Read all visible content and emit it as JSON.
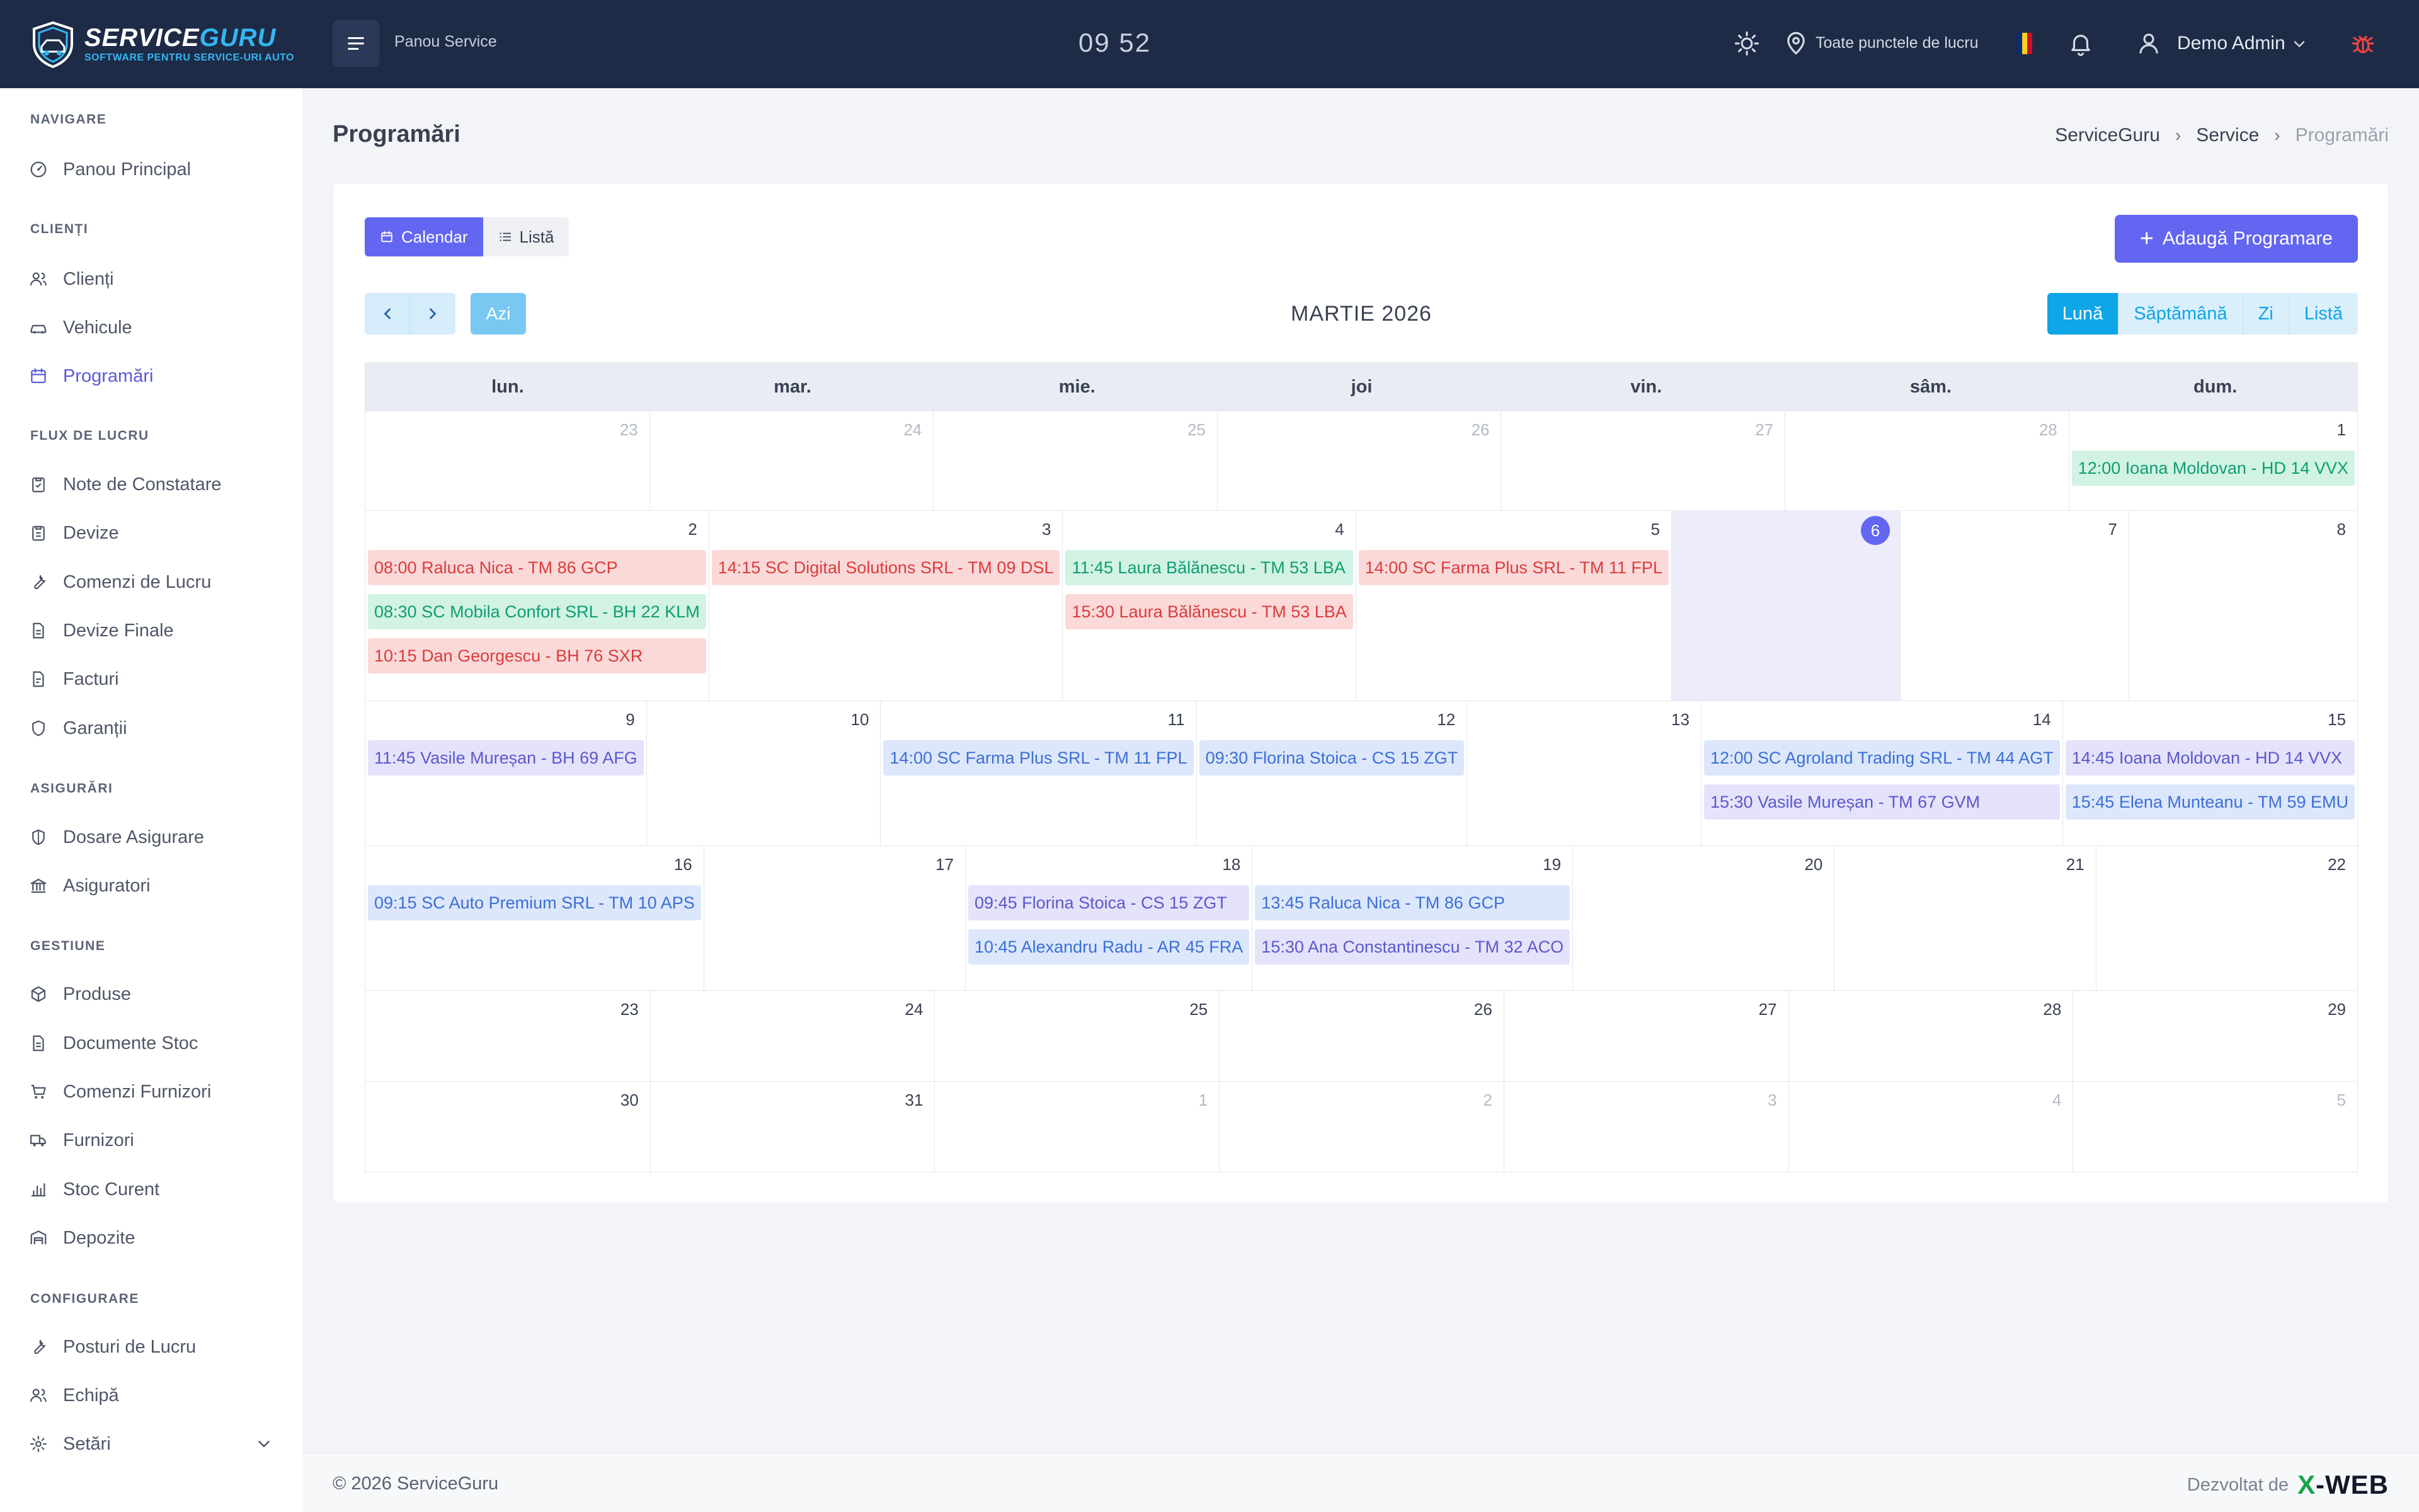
{
  "topbar": {
    "logo_title_a": "SERVICE",
    "logo_title_b": "GURU",
    "logo_subtitle": "SOFTWARE PENTRU SERVICE-URI AUTO",
    "panel_label": "Panou Service",
    "clock": "09 52",
    "location": "Toate punctele de lucru",
    "user_name": "Demo Admin"
  },
  "sidebar": {
    "sections": [
      {
        "title": "NAVIGARE",
        "items": [
          {
            "label": "Panou Principal",
            "icon": "dashboard-icon"
          }
        ]
      },
      {
        "title": "CLIENȚI",
        "items": [
          {
            "label": "Clienți",
            "icon": "users-icon"
          },
          {
            "label": "Vehicule",
            "icon": "car-icon"
          },
          {
            "label": "Programări",
            "icon": "calendar-icon",
            "active": true
          }
        ]
      },
      {
        "title": "FLUX DE LUCRU",
        "items": [
          {
            "label": "Note de Constatare",
            "icon": "clipboard-icon"
          },
          {
            "label": "Devize",
            "icon": "clipboard-icon"
          },
          {
            "label": "Comenzi de Lucru",
            "icon": "wrench-icon"
          },
          {
            "label": "Devize Finale",
            "icon": "document-icon"
          },
          {
            "label": "Facturi",
            "icon": "document-icon"
          },
          {
            "label": "Garanții",
            "icon": "shield-icon"
          }
        ]
      },
      {
        "title": "ASIGURĂRI",
        "items": [
          {
            "label": "Dosare Asigurare",
            "icon": "shield-icon"
          },
          {
            "label": "Asiguratori",
            "icon": "bank-icon"
          }
        ]
      },
      {
        "title": "GESTIUNE",
        "items": [
          {
            "label": "Produse",
            "icon": "box-icon"
          },
          {
            "label": "Documente Stoc",
            "icon": "document-icon"
          },
          {
            "label": "Comenzi Furnizori",
            "icon": "cart-icon"
          },
          {
            "label": "Furnizori",
            "icon": "truck-icon"
          },
          {
            "label": "Stoc Curent",
            "icon": "bar-chart-icon"
          },
          {
            "label": "Depozite",
            "icon": "warehouse-icon"
          }
        ]
      },
      {
        "title": "CONFIGURARE",
        "items": [
          {
            "label": "Posturi de Lucru",
            "icon": "wrench-icon"
          },
          {
            "label": "Echipă",
            "icon": "users-icon"
          },
          {
            "label": "Setări",
            "icon": "gear-icon"
          }
        ]
      }
    ]
  },
  "page": {
    "title": "Programări",
    "breadcrumb": [
      "ServiceGuru",
      "Service",
      "Programări"
    ]
  },
  "calendar": {
    "view_toggle": {
      "calendar": "Calendar",
      "list": "Listă"
    },
    "add_button": "Adaugă Programare",
    "today_button": "Azi",
    "month_title": "MARTIE 2026",
    "view_switch": [
      "Lună",
      "Săptămână",
      "Zi",
      "Listă"
    ],
    "weekdays": [
      "lun.",
      "mar.",
      "mie.",
      "joi",
      "vin.",
      "sâm.",
      "dum."
    ],
    "weeks": [
      [
        {
          "day": "23",
          "other": true,
          "events": []
        },
        {
          "day": "24",
          "other": true,
          "events": []
        },
        {
          "day": "25",
          "other": true,
          "events": []
        },
        {
          "day": "26",
          "other": true,
          "events": []
        },
        {
          "day": "27",
          "other": true,
          "events": []
        },
        {
          "day": "28",
          "other": true,
          "events": []
        },
        {
          "day": "1",
          "events": [
            {
              "text": "12:00 Ioana Moldovan - HD 14 VVX",
              "color": "green"
            }
          ]
        }
      ],
      [
        {
          "day": "2",
          "events": [
            {
              "text": "08:00 Raluca Nica - TM 86 GCP",
              "color": "red"
            },
            {
              "text": "08:30 SC Mobila Confort SRL - BH 22 KLM",
              "color": "green"
            },
            {
              "text": "10:15 Dan Georgescu - BH 76 SXR",
              "color": "red"
            }
          ]
        },
        {
          "day": "3",
          "events": [
            {
              "text": "14:15 SC Digital Solutions SRL - TM 09 DSL",
              "color": "red"
            }
          ]
        },
        {
          "day": "4",
          "events": [
            {
              "text": "11:45 Laura Bălănescu - TM 53 LBA",
              "color": "green"
            },
            {
              "text": "15:30 Laura Bălănescu - TM 53 LBA",
              "color": "red"
            }
          ]
        },
        {
          "day": "5",
          "events": [
            {
              "text": "14:00 SC Farma Plus SRL - TM 11 FPL",
              "color": "red"
            }
          ]
        },
        {
          "day": "6",
          "today": true,
          "events": []
        },
        {
          "day": "7",
          "events": []
        },
        {
          "day": "8",
          "events": []
        }
      ],
      [
        {
          "day": "9",
          "events": [
            {
              "text": "11:45 Vasile Mureșan - BH 69 AFG",
              "color": "purple"
            }
          ]
        },
        {
          "day": "10",
          "events": []
        },
        {
          "day": "11",
          "events": [
            {
              "text": "14:00 SC Farma Plus SRL - TM 11 FPL",
              "color": "blue"
            }
          ]
        },
        {
          "day": "12",
          "events": [
            {
              "text": "09:30 Florina Stoica - CS 15 ZGT",
              "color": "blue"
            }
          ]
        },
        {
          "day": "13",
          "events": []
        },
        {
          "day": "14",
          "events": [
            {
              "text": "12:00 SC Agroland Trading SRL - TM 44 AGT",
              "color": "blue"
            },
            {
              "text": "15:30 Vasile Mureșan - TM 67 GVM",
              "color": "purple"
            }
          ]
        },
        {
          "day": "15",
          "events": [
            {
              "text": "14:45 Ioana Moldovan - HD 14 VVX",
              "color": "purple"
            },
            {
              "text": "15:45 Elena Munteanu - TM 59 EMU",
              "color": "blue"
            }
          ]
        }
      ],
      [
        {
          "day": "16",
          "events": [
            {
              "text": "09:15 SC Auto Premium SRL - TM 10 APS",
              "color": "blue"
            }
          ]
        },
        {
          "day": "17",
          "events": []
        },
        {
          "day": "18",
          "events": [
            {
              "text": "09:45 Florina Stoica - CS 15 ZGT",
              "color": "purple"
            },
            {
              "text": "10:45 Alexandru Radu - AR 45 FRA",
              "color": "blue"
            }
          ]
        },
        {
          "day": "19",
          "events": [
            {
              "text": "13:45 Raluca Nica - TM 86 GCP",
              "color": "blue"
            },
            {
              "text": "15:30 Ana Constantinescu - TM 32 ACO",
              "color": "purple"
            }
          ]
        },
        {
          "day": "20",
          "events": []
        },
        {
          "day": "21",
          "events": []
        },
        {
          "day": "22",
          "events": []
        }
      ],
      [
        {
          "day": "23",
          "events": []
        },
        {
          "day": "24",
          "events": []
        },
        {
          "day": "25",
          "events": []
        },
        {
          "day": "26",
          "events": []
        },
        {
          "day": "27",
          "events": []
        },
        {
          "day": "28",
          "events": []
        },
        {
          "day": "29",
          "events": []
        }
      ],
      [
        {
          "day": "30",
          "events": []
        },
        {
          "day": "31",
          "events": []
        },
        {
          "day": "1",
          "other": true,
          "events": []
        },
        {
          "day": "2",
          "other": true,
          "events": []
        },
        {
          "day": "3",
          "other": true,
          "events": []
        },
        {
          "day": "4",
          "other": true,
          "events": []
        },
        {
          "day": "5",
          "other": true,
          "events": []
        }
      ]
    ]
  },
  "footer": {
    "copyright": "© 2026 ServiceGuru",
    "developed_by": "Dezvoltat de",
    "dev_brand_a": "X",
    "dev_brand_b": "-WEB"
  },
  "colors": {
    "accent": "#6366f1",
    "topbar": "#1d2b46",
    "sky": "#0ea5e9"
  }
}
